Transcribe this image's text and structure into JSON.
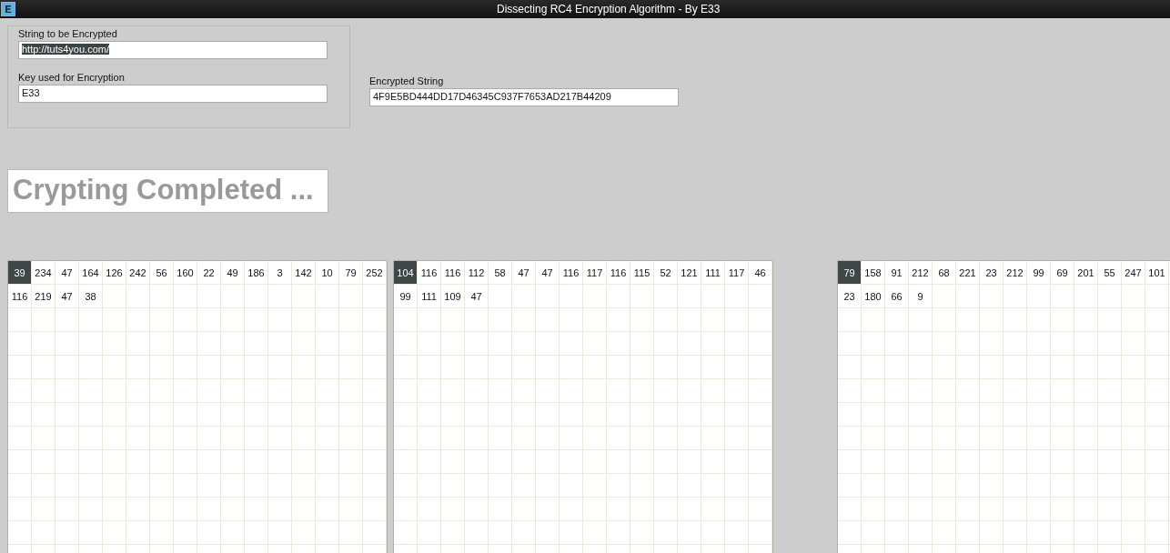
{
  "window": {
    "title": "Dissecting RC4 Encryption Algorithm - By E33"
  },
  "input_group": {
    "fields": [
      {
        "label": "String to be Encrypted",
        "value": "http://tuts4you.com/",
        "highlighted": true
      },
      {
        "label": "Key used for Encryption",
        "value": "E33",
        "highlighted": false
      }
    ]
  },
  "output": {
    "label": "Encrypted String",
    "value": "4F9E5BD444DD17D46345C937F7653AD217B44209"
  },
  "status": {
    "text": "Crypting Completed ..."
  },
  "grids": [
    {
      "rows": [
        [
          {
            "text": "39",
            "selected": true
          },
          {
            "text": "234",
            "selected": false
          },
          {
            "text": "47",
            "selected": false
          },
          {
            "text": "164",
            "selected": false
          },
          {
            "text": "126",
            "selected": false
          },
          {
            "text": "242",
            "selected": false
          },
          {
            "text": "56",
            "selected": false
          },
          {
            "text": "160",
            "selected": false
          },
          {
            "text": "22",
            "selected": false
          },
          {
            "text": "49",
            "selected": false
          },
          {
            "text": "186",
            "selected": false
          },
          {
            "text": "3",
            "selected": false
          },
          {
            "text": "142",
            "selected": false
          },
          {
            "text": "10",
            "selected": false
          },
          {
            "text": "79",
            "selected": false
          },
          {
            "text": "252",
            "selected": false
          }
        ],
        [
          {
            "text": "116",
            "selected": false
          },
          {
            "text": "219",
            "selected": false
          },
          {
            "text": "47",
            "selected": false
          },
          {
            "text": "38",
            "selected": false
          }
        ]
      ]
    },
    {
      "rows": [
        [
          {
            "text": "104",
            "selected": true
          },
          {
            "text": "116",
            "selected": false
          },
          {
            "text": "116",
            "selected": false
          },
          {
            "text": "112",
            "selected": false
          },
          {
            "text": "58",
            "selected": false
          },
          {
            "text": "47",
            "selected": false
          },
          {
            "text": "47",
            "selected": false
          },
          {
            "text": "116",
            "selected": false
          },
          {
            "text": "117",
            "selected": false
          },
          {
            "text": "116",
            "selected": false
          },
          {
            "text": "115",
            "selected": false
          },
          {
            "text": "52",
            "selected": false
          },
          {
            "text": "121",
            "selected": false
          },
          {
            "text": "111",
            "selected": false
          },
          {
            "text": "117",
            "selected": false
          },
          {
            "text": "46",
            "selected": false
          }
        ],
        [
          {
            "text": "99",
            "selected": false
          },
          {
            "text": "111",
            "selected": false
          },
          {
            "text": "109",
            "selected": false
          },
          {
            "text": "47",
            "selected": false
          }
        ]
      ]
    },
    {
      "rows": [
        [
          {
            "text": "79",
            "selected": true
          },
          {
            "text": "158",
            "selected": false
          },
          {
            "text": "91",
            "selected": false
          },
          {
            "text": "212",
            "selected": false
          },
          {
            "text": "68",
            "selected": false
          },
          {
            "text": "221",
            "selected": false
          },
          {
            "text": "23",
            "selected": false
          },
          {
            "text": "212",
            "selected": false
          },
          {
            "text": "99",
            "selected": false
          },
          {
            "text": "69",
            "selected": false
          },
          {
            "text": "201",
            "selected": false
          },
          {
            "text": "55",
            "selected": false
          },
          {
            "text": "247",
            "selected": false
          },
          {
            "text": "101",
            "selected": false
          }
        ],
        [
          {
            "text": "23",
            "selected": false
          },
          {
            "text": "180",
            "selected": false
          },
          {
            "text": "66",
            "selected": false
          },
          {
            "text": "9",
            "selected": false
          }
        ]
      ]
    }
  ]
}
